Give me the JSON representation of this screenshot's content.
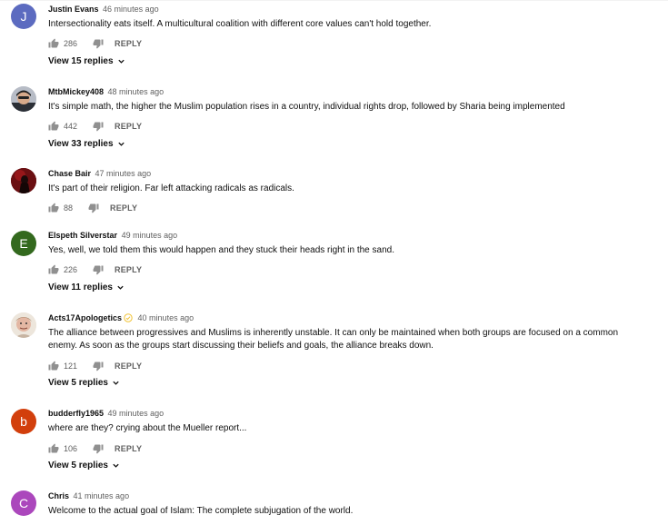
{
  "comments": [
    {
      "author": "Justin Evans",
      "time": "46 minutes ago",
      "text": "Intersectionality eats itself. A multicultural coalition with different core values can't hold together.",
      "likes": "286",
      "reply_label": "REPLY",
      "view_replies": "View 15 replies",
      "avatar": {
        "type": "letter",
        "letter": "J",
        "color": "#5c6bc0"
      }
    },
    {
      "author": "MtbMickey408",
      "time": "48 minutes ago",
      "text": "It's simple math, the higher the Muslim population rises in a country, individual rights drop, followed by Sharia being implemented",
      "likes": "442",
      "reply_label": "REPLY",
      "view_replies": "View 33 replies",
      "avatar": {
        "type": "photo"
      }
    },
    {
      "author": "Chase Bair",
      "time": "47 minutes ago",
      "text": "It's part of their religion. Far left attacking radicals as radicals.",
      "likes": "88",
      "reply_label": "REPLY",
      "avatar": {
        "type": "photo"
      }
    },
    {
      "author": "Elspeth Silverstar",
      "time": "49 minutes ago",
      "text": "Yes, well, we told them this would happen and they stuck their heads right in the sand.",
      "likes": "226",
      "reply_label": "REPLY",
      "view_replies": "View 11 replies",
      "avatar": {
        "type": "letter",
        "letter": "E",
        "color": "#33691e"
      }
    },
    {
      "author": "Acts17Apologetics",
      "time": "40 minutes ago",
      "text": "The alliance between progressives and Muslims is inherently unstable. It can only be maintained when both groups are focused on a common enemy. As soon as the groups start discussing their beliefs and goals, the alliance breaks down.",
      "likes": "121",
      "reply_label": "REPLY",
      "view_replies": "View 5 replies",
      "avatar": {
        "type": "photo"
      },
      "badge_icon": "verified-check-icon"
    },
    {
      "author": "budderfly1965",
      "time": "49 minutes ago",
      "text": "where are they? crying about the Mueller report...",
      "likes": "106",
      "reply_label": "REPLY",
      "view_replies": "View 5 replies",
      "avatar": {
        "type": "letter",
        "letter": "b",
        "color": "#d23f0c"
      }
    },
    {
      "author": "Chris",
      "time": "41 minutes ago",
      "text": "Welcome to the actual goal of Islam: The complete subjugation of the world.",
      "avatar": {
        "type": "letter",
        "letter": "C",
        "color": "#ab47bc"
      }
    }
  ],
  "icons": {
    "like": "thumbs-up-icon",
    "dislike": "thumbs-down-icon",
    "expand": "chevron-down-icon"
  },
  "colors": {
    "text": "#0f0f0f",
    "secondary": "#606060"
  }
}
